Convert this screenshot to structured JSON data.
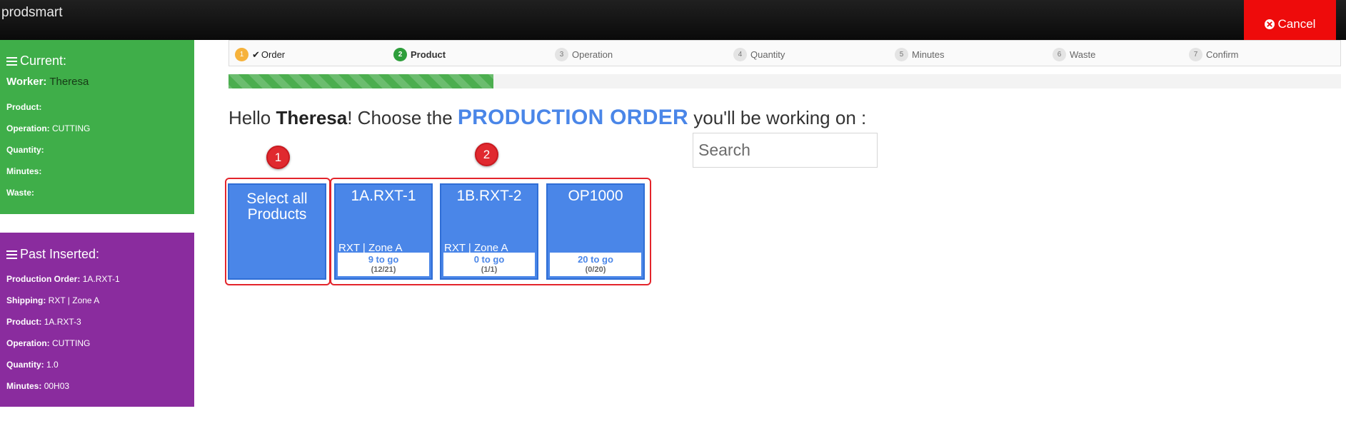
{
  "app": {
    "brand": "prodsmart",
    "cancel_label": "Cancel"
  },
  "current": {
    "title": "Current:",
    "worker_label": "Worker:",
    "worker_value": "Theresa",
    "rows": [
      {
        "label": "Product:",
        "value": ""
      },
      {
        "label": "Operation:",
        "value": "CUTTING"
      },
      {
        "label": "Quantity:",
        "value": ""
      },
      {
        "label": "Minutes:",
        "value": ""
      },
      {
        "label": "Waste:",
        "value": ""
      }
    ]
  },
  "past": {
    "title": "Past Inserted:",
    "rows": [
      {
        "label": "Production Order:",
        "value": "1A.RXT-1"
      },
      {
        "label": "Shipping:",
        "value": "RXT | Zone A"
      },
      {
        "label": "Product:",
        "value": "1A.RXT-3"
      },
      {
        "label": "Operation:",
        "value": "CUTTING"
      },
      {
        "label": "Quantity:",
        "value": "1.0"
      },
      {
        "label": "Minutes:",
        "value": "00H03"
      }
    ]
  },
  "wizard": {
    "steps": [
      {
        "num": "1",
        "label": "Order",
        "check": "✔"
      },
      {
        "num": "2",
        "label": "Product"
      },
      {
        "num": "3",
        "label": "Operation"
      },
      {
        "num": "4",
        "label": "Quantity"
      },
      {
        "num": "5",
        "label": "Minutes"
      },
      {
        "num": "6",
        "label": "Waste"
      },
      {
        "num": "7",
        "label": "Confirm"
      }
    ],
    "progress_fraction": 0.238
  },
  "heading": {
    "prefix": "Hello ",
    "name": "Theresa",
    "mid": "! Choose the ",
    "highlight": "PRODUCTION ORDER",
    "suffix": " you'll be working on :"
  },
  "search": {
    "placeholder": "Search"
  },
  "markers": [
    "1",
    "2"
  ],
  "select_all": {
    "label": "Select all Products"
  },
  "cards": [
    {
      "title": "1A.RXT-1",
      "sub": "RXT | Zone A",
      "togo": "9 to go",
      "count": "(12/21)"
    },
    {
      "title": "1B.RXT-2",
      "sub": "RXT | Zone A",
      "togo": "0 to go",
      "count": "(1/1)"
    },
    {
      "title": "OP1000",
      "sub": "",
      "togo": "20 to go",
      "count": "(0/20)"
    }
  ],
  "colors": {
    "accent_blue": "#4a86e8",
    "current_green": "#3fae49",
    "past_purple": "#8a2c9e",
    "cancel_red": "#ee0b0b"
  },
  "icons": {
    "cancel": "times-circle-icon",
    "menu": "bars-icon",
    "check": "check-icon"
  }
}
